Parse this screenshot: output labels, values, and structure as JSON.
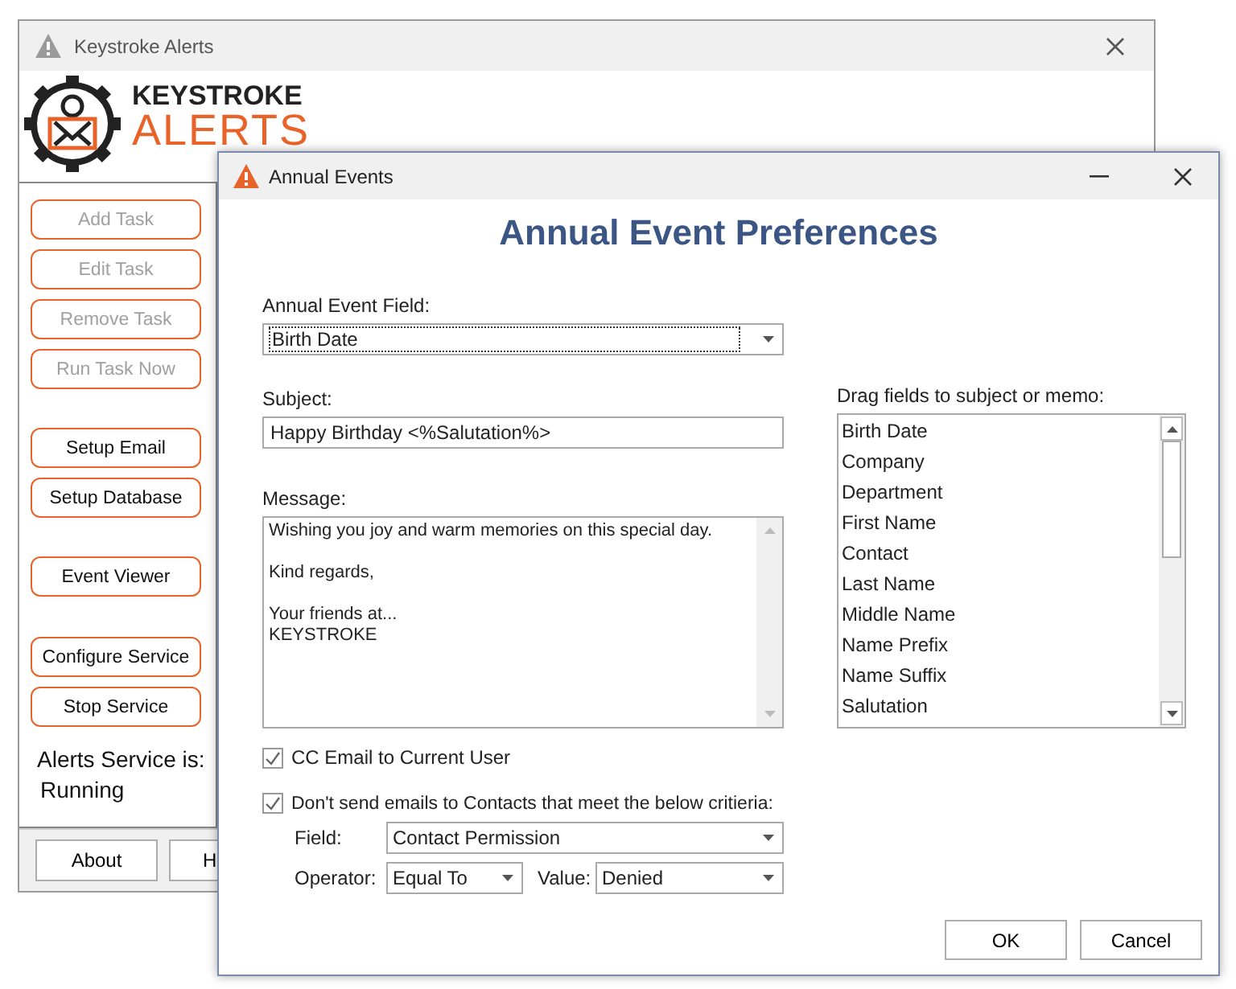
{
  "main_window": {
    "title": "Keystroke Alerts",
    "logo": {
      "line_1": "KEYSTROKE",
      "line_2": "ALERTS"
    },
    "button_groups": [
      [
        {
          "label": "Add Task",
          "disabled": true
        },
        {
          "label": "Edit Task",
          "disabled": true
        },
        {
          "label": "Remove Task",
          "disabled": true
        },
        {
          "label": "Run Task Now",
          "disabled": true
        }
      ],
      [
        {
          "label": "Setup Email",
          "disabled": false
        },
        {
          "label": "Setup Database",
          "disabled": false
        }
      ],
      [
        {
          "label": "Event Viewer",
          "disabled": false
        }
      ],
      [
        {
          "label": "Configure Service",
          "disabled": false
        },
        {
          "label": "Stop Service",
          "disabled": false
        }
      ]
    ],
    "service_status": {
      "label": "Alerts Service is:",
      "value": "Running"
    },
    "footer_buttons": [
      "About",
      "H"
    ]
  },
  "dialog": {
    "title": "Annual Events",
    "heading": "Annual Event Preferences",
    "event_field": {
      "label": "Annual Event Field:",
      "value": "Birth Date"
    },
    "subject": {
      "label": "Subject:",
      "value": "Happy Birthday <%Salutation%>"
    },
    "message": {
      "label": "Message:",
      "value": "Wishing you joy and warm memories on this special day.\n\nKind regards,\n\nYour friends at...\nKEYSTROKE"
    },
    "fields_list": {
      "label": "Drag fields to subject or memo:",
      "items": [
        "Birth Date",
        "Company",
        "Department",
        "First Name",
        "Contact",
        "Last Name",
        "Middle Name",
        "Name Prefix",
        "Name Suffix",
        "Salutation"
      ]
    },
    "cc_email": {
      "label": "CC Email to Current User",
      "checked": true
    },
    "exclude": {
      "label": "Don't send emails to Contacts that meet the below critieria:",
      "checked": true
    },
    "criteria": {
      "field_label": "Field:",
      "field_value": "Contact Permission",
      "operator_label": "Operator:",
      "operator_value": "Equal To",
      "value_label": "Value:",
      "value_value": "Denied"
    },
    "buttons": [
      "OK",
      "Cancel"
    ]
  }
}
